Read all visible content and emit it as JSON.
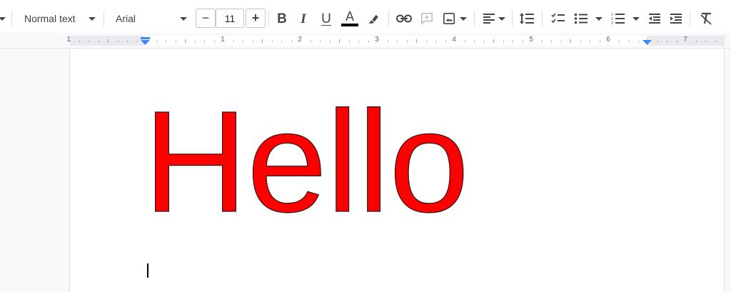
{
  "toolbar": {
    "style_dropdown": {
      "value": "Normal text"
    },
    "font_dropdown": {
      "value": "Arial"
    },
    "font_size": {
      "value": "11",
      "decrease_label": "−",
      "increase_label": "+"
    },
    "format": {
      "bold": "B",
      "italic": "I",
      "underline": "U",
      "text_color": "A"
    },
    "text_color_swatch": "#000000",
    "icons": [
      "dropdown-caret",
      "link",
      "comment",
      "image",
      "align-left",
      "line-spacing",
      "checklist",
      "bulleted-list",
      "numbered-list",
      "decrease-indent",
      "increase-indent",
      "clear-formatting",
      "highlighter"
    ]
  },
  "ruler": {
    "numbers": [
      "1",
      "1",
      "2",
      "3",
      "4",
      "5",
      "6",
      "7"
    ]
  },
  "document": {
    "text": "Hello",
    "text_color": "#ff0000"
  }
}
